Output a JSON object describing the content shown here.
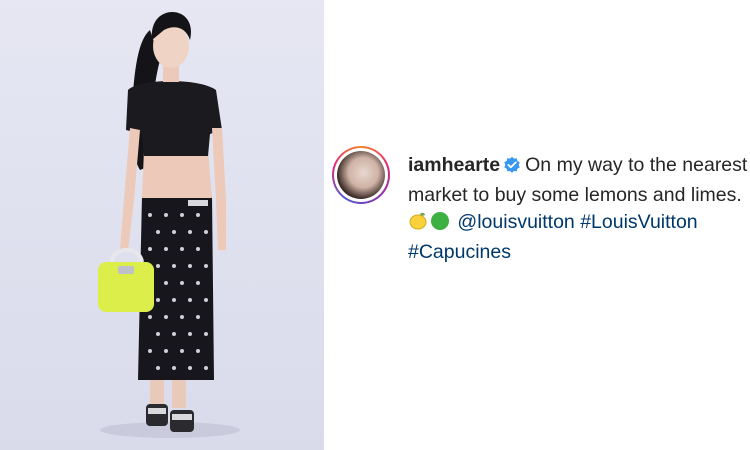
{
  "post": {
    "username": "iamhearte",
    "caption_text": "On my way to the nearest market to buy some lemons and limes.",
    "emojis": [
      "lemon-emoji",
      "green-circle-emoji"
    ],
    "mention": "@louisvuitton",
    "hashtags": [
      "#LouisVuitton",
      "#Capucines"
    ]
  },
  "colors": {
    "verified_badge": "#3897f0",
    "link": "#00376b",
    "text": "#262626"
  }
}
